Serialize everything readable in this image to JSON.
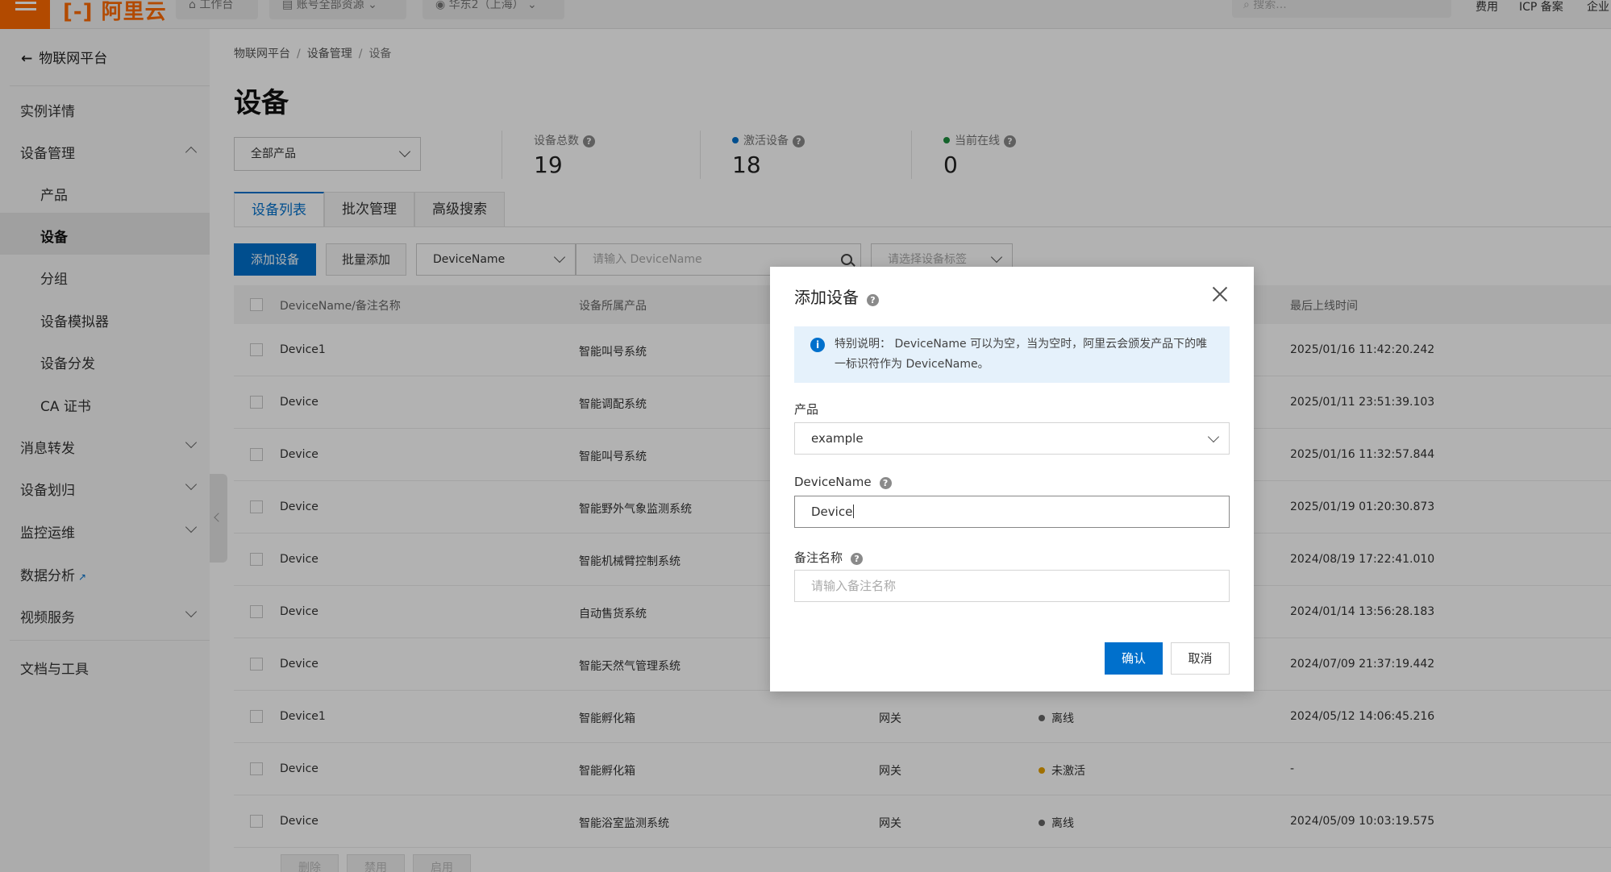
{
  "topbar": {
    "logo": "[-] 阿里云",
    "workbench": "工作台",
    "account_scope": "账号全部资源",
    "region": "华东2（上海）",
    "search_placeholder": "搜索...",
    "links": [
      "费用",
      "ICP 备案",
      "企业"
    ]
  },
  "sidebar": {
    "back_label": "物联网平台",
    "items": [
      {
        "label": "实例详情"
      },
      {
        "label": "设备管理",
        "expanded": true,
        "children": [
          "产品",
          "设备",
          "分组",
          "设备模拟器",
          "设备分发",
          "CA 证书"
        ],
        "active_child": "设备"
      },
      {
        "label": "消息转发"
      },
      {
        "label": "设备划归"
      },
      {
        "label": "监控运维"
      },
      {
        "label": "数据分析"
      },
      {
        "label": "视频服务"
      },
      {
        "label": "文档与工具"
      }
    ]
  },
  "breadcrumb": [
    "物联网平台",
    "设备管理",
    "设备"
  ],
  "page_title": "设备",
  "product_filter": "全部产品",
  "stats": [
    {
      "label": "设备总数",
      "value": "19"
    },
    {
      "label": "激活设备",
      "value": "18",
      "dot_color": "#0070cc"
    },
    {
      "label": "当前在线",
      "value": "0",
      "dot_color": "#1e8e3e"
    }
  ],
  "tabs": [
    "设备列表",
    "批次管理",
    "高级搜索"
  ],
  "toolbar": {
    "add_device": "添加设备",
    "batch_add": "批量添加",
    "search_field": "DeviceName",
    "search_placeholder": "请输入 DeviceName",
    "tag_placeholder": "请选择设备标签"
  },
  "table": {
    "headers": {
      "name": "DeviceName/备注名称",
      "product": "设备所属产品",
      "last_online": "最后上线时间"
    },
    "rows": [
      {
        "name": "Device1",
        "product": "智能叫号系统",
        "type": "",
        "status": "",
        "status_color": "",
        "last_online": "2025/01/16 11:42:20.242"
      },
      {
        "name": "Device",
        "product": "智能调配系统",
        "type": "",
        "status": "",
        "status_color": "",
        "last_online": "2025/01/11 23:51:39.103"
      },
      {
        "name": "Device",
        "product": "智能叫号系统",
        "type": "",
        "status": "",
        "status_color": "",
        "last_online": "2025/01/16 11:32:57.844"
      },
      {
        "name": "Device",
        "product": "智能野外气象监测系统",
        "type": "",
        "status": "",
        "status_color": "",
        "last_online": "2025/01/19 01:20:30.873"
      },
      {
        "name": "Device",
        "product": "智能机械臂控制系统",
        "type": "",
        "status": "",
        "status_color": "",
        "last_online": "2024/08/19 17:22:41.010"
      },
      {
        "name": "Device",
        "product": "自动售货系统",
        "type": "",
        "status": "",
        "status_color": "",
        "last_online": "2024/01/14 13:56:28.183"
      },
      {
        "name": "Device",
        "product": "智能天然气管理系统",
        "type": "",
        "status": "",
        "status_color": "",
        "last_online": "2024/07/09 21:37:19.442"
      },
      {
        "name": "Device1",
        "product": "智能孵化箱",
        "type": "网关",
        "status": "离线",
        "status_color": "#666666",
        "last_online": "2024/05/12 14:06:45.216"
      },
      {
        "name": "Device",
        "product": "智能孵化箱",
        "type": "网关",
        "status": "未激活",
        "status_color": "#e6a100",
        "last_online": "-"
      },
      {
        "name": "Device",
        "product": "智能浴室监测系统",
        "type": "网关",
        "status": "离线",
        "status_color": "#666666",
        "last_online": "2024/05/09 10:03:19.575"
      }
    ]
  },
  "bottom_actions": [
    "删除",
    "禁用",
    "启用"
  ],
  "modal": {
    "title": "添加设备",
    "notice": "特别说明： DeviceName 可以为空，当为空时，阿里云会颁发产品下的唯一标识符作为 DeviceName。",
    "product_label": "产品",
    "product_value": "example",
    "devicename_label": "DeviceName",
    "devicename_value": "Device",
    "alias_label": "备注名称",
    "alias_placeholder": "请输入备注名称",
    "confirm": "确认",
    "cancel": "取消"
  }
}
